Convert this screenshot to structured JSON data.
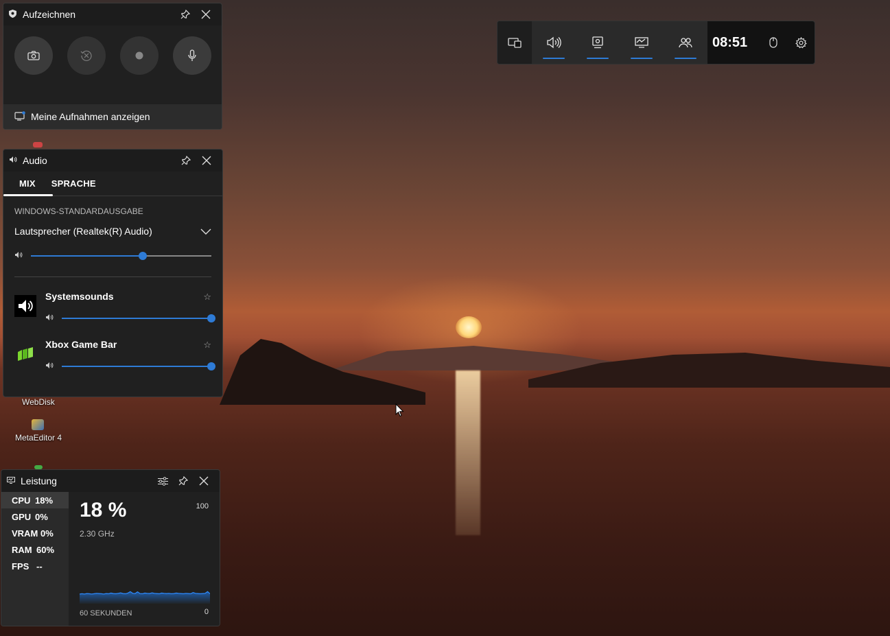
{
  "capture": {
    "title": "Aufzeichnen",
    "show_recordings_label": "Meine Aufnahmen anzeigen",
    "buttons": [
      {
        "name": "screenshot",
        "icon": "camera-icon"
      },
      {
        "name": "record-last-30s",
        "icon": "history-icon"
      },
      {
        "name": "start-recording",
        "icon": "record-dot-icon"
      },
      {
        "name": "microphone",
        "icon": "microphone-icon"
      }
    ]
  },
  "audio": {
    "title": "Audio",
    "tabs": [
      "MIX",
      "SPRACHE"
    ],
    "active_tab": "MIX",
    "section_label": "WINDOWS-STANDARDAUSGABE",
    "device": "Lautsprecher (Realtek(R) Audio)",
    "master_volume": 0.62,
    "apps": [
      {
        "name": "Systemsounds",
        "volume": 1.0
      },
      {
        "name": "Xbox Game Bar",
        "volume": 1.0
      }
    ]
  },
  "performance": {
    "title": "Leistung",
    "metrics": [
      {
        "key": "CPU",
        "value": "18%"
      },
      {
        "key": "GPU",
        "value": "0%"
      },
      {
        "key": "VRAM",
        "value": "0%"
      },
      {
        "key": "RAM",
        "value": "60%"
      },
      {
        "key": "FPS",
        "value": "--"
      }
    ],
    "active_metric": "CPU",
    "big_value": "18 %",
    "frequency": "2.30 GHz",
    "max": "100",
    "min": "0",
    "timespan": "60 SEKUNDEN",
    "history": [
      12,
      13,
      12,
      14,
      13,
      12,
      13,
      15,
      14,
      13,
      12,
      14,
      13,
      16,
      14,
      13,
      15,
      17,
      14,
      13,
      16,
      22,
      15,
      14,
      21,
      14,
      13,
      16,
      15,
      14,
      17,
      15,
      14,
      13,
      16,
      15,
      14,
      15,
      13,
      14,
      16,
      15,
      14,
      13,
      15,
      14,
      13,
      18,
      15,
      14,
      13,
      14,
      15,
      22,
      13
    ]
  },
  "gamebar": {
    "time": "08:51"
  },
  "desktop": {
    "labels": [
      "WebDisk",
      "MetaEditor 4"
    ]
  },
  "colors": {
    "accent": "#2e7bd6",
    "panel": "#202020"
  }
}
